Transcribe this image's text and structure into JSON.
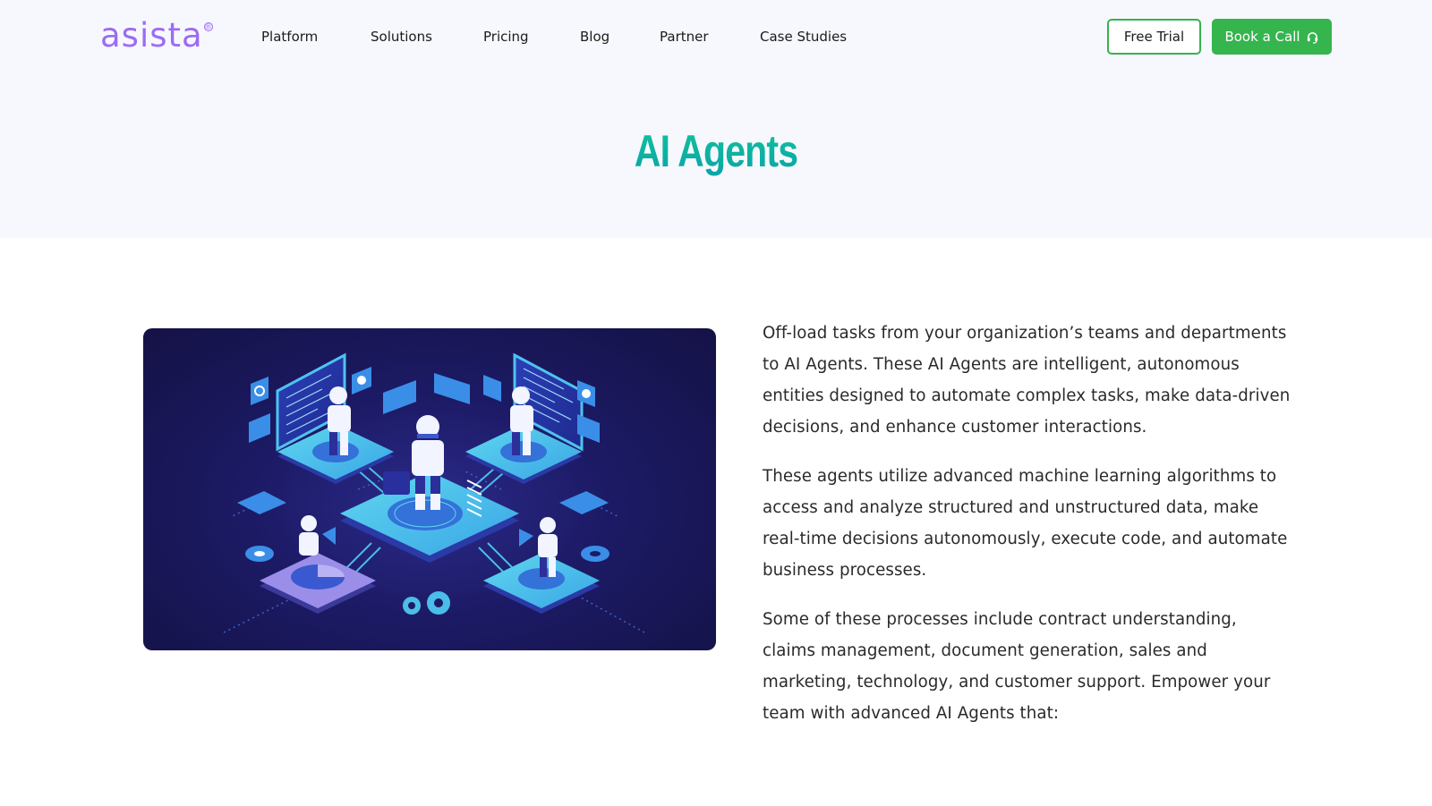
{
  "brand": {
    "name": "asista",
    "registered_mark": "®",
    "color": "#9b6cf3"
  },
  "nav": {
    "items": [
      {
        "label": "Platform"
      },
      {
        "label": "Solutions"
      },
      {
        "label": "Pricing"
      },
      {
        "label": "Blog"
      },
      {
        "label": "Partner"
      },
      {
        "label": "Case Studies"
      }
    ],
    "free_trial_label": "Free Trial",
    "book_call_label": "Book a Call",
    "book_call_icon": "headset-icon",
    "accent_color": "#36b44e"
  },
  "hero": {
    "title": "AI Agents",
    "title_colors": [
      "#11c39a",
      "#0aa3a9"
    ]
  },
  "illustration": {
    "description": "Isometric illustration of robot AI agents on connected platforms with screens, gears and charts"
  },
  "content": {
    "paragraphs": [
      "Off-load tasks from your organization’s teams and departments to AI Agents. These AI Agents are intelligent, autonomous entities designed to automate complex tasks, make data-driven decisions, and enhance customer interactions.",
      "These agents utilize advanced machine learning algorithms to access and analyze structured and unstructured data, make real-time decisions autonomously, execute code, and automate business processes.",
      "Some of these processes include contract understanding, claims management, document generation, sales and marketing, technology, and customer support. Empower your team with advanced AI Agents that:"
    ]
  }
}
